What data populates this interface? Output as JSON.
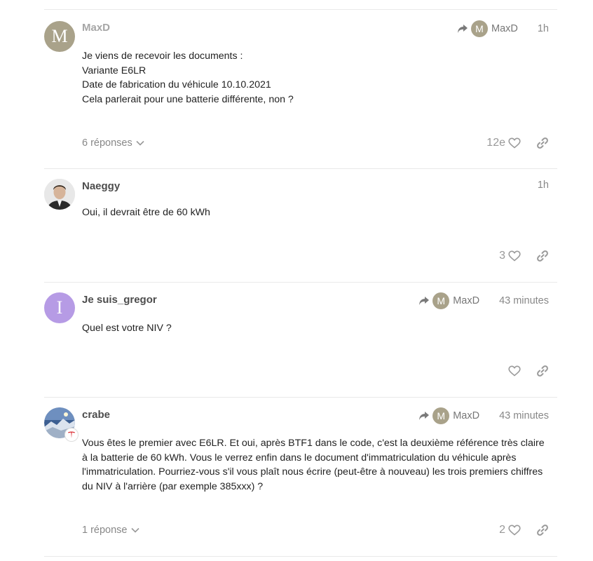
{
  "posts": [
    {
      "username": "MaxD",
      "avatar_letter": "M",
      "reply_to": "MaxD",
      "reply_to_letter": "M",
      "time": "1h",
      "lines": [
        "Je viens de recevoir les documents :",
        "Variante E6LR",
        "Date de fabrication du véhicule 10.10.2021",
        "Cela parlerait pour une batterie différente, non ?"
      ],
      "replies": "6 réponses",
      "likes": "12e"
    },
    {
      "username": "Naeggy",
      "time": "1h",
      "lines": [
        "Oui, il devrait être de 60 kWh"
      ],
      "likes": "3"
    },
    {
      "username": "Je suis_gregor",
      "avatar_letter": "I",
      "reply_to": "MaxD",
      "reply_to_letter": "M",
      "time": "43 minutes",
      "lines": [
        "Quel est votre NIV ?"
      ],
      "likes": ""
    },
    {
      "username": "crabe",
      "reply_to": "MaxD",
      "reply_to_letter": "M",
      "time": "43 minutes",
      "lines": [
        "Vous êtes le premier avec E6LR. Et oui, après BTF1 dans le code, c'est la deuxième référence très claire à la batterie de 60 kWh. Vous le verrez enfin dans le document d'immatriculation du véhicule après l'immatriculation. Pourriez-vous s'il vous plaît nous écrire (peut-être à nouveau) les trois premiers chiffres du NIV à l'arrière (par exemple 385xxx) ?"
      ],
      "replies": "1 réponse",
      "likes": "2"
    }
  ],
  "colors": {
    "maxd_avatar": "#a9a28a",
    "gregor_avatar": "#b69be5",
    "muted_text": "#888888"
  }
}
